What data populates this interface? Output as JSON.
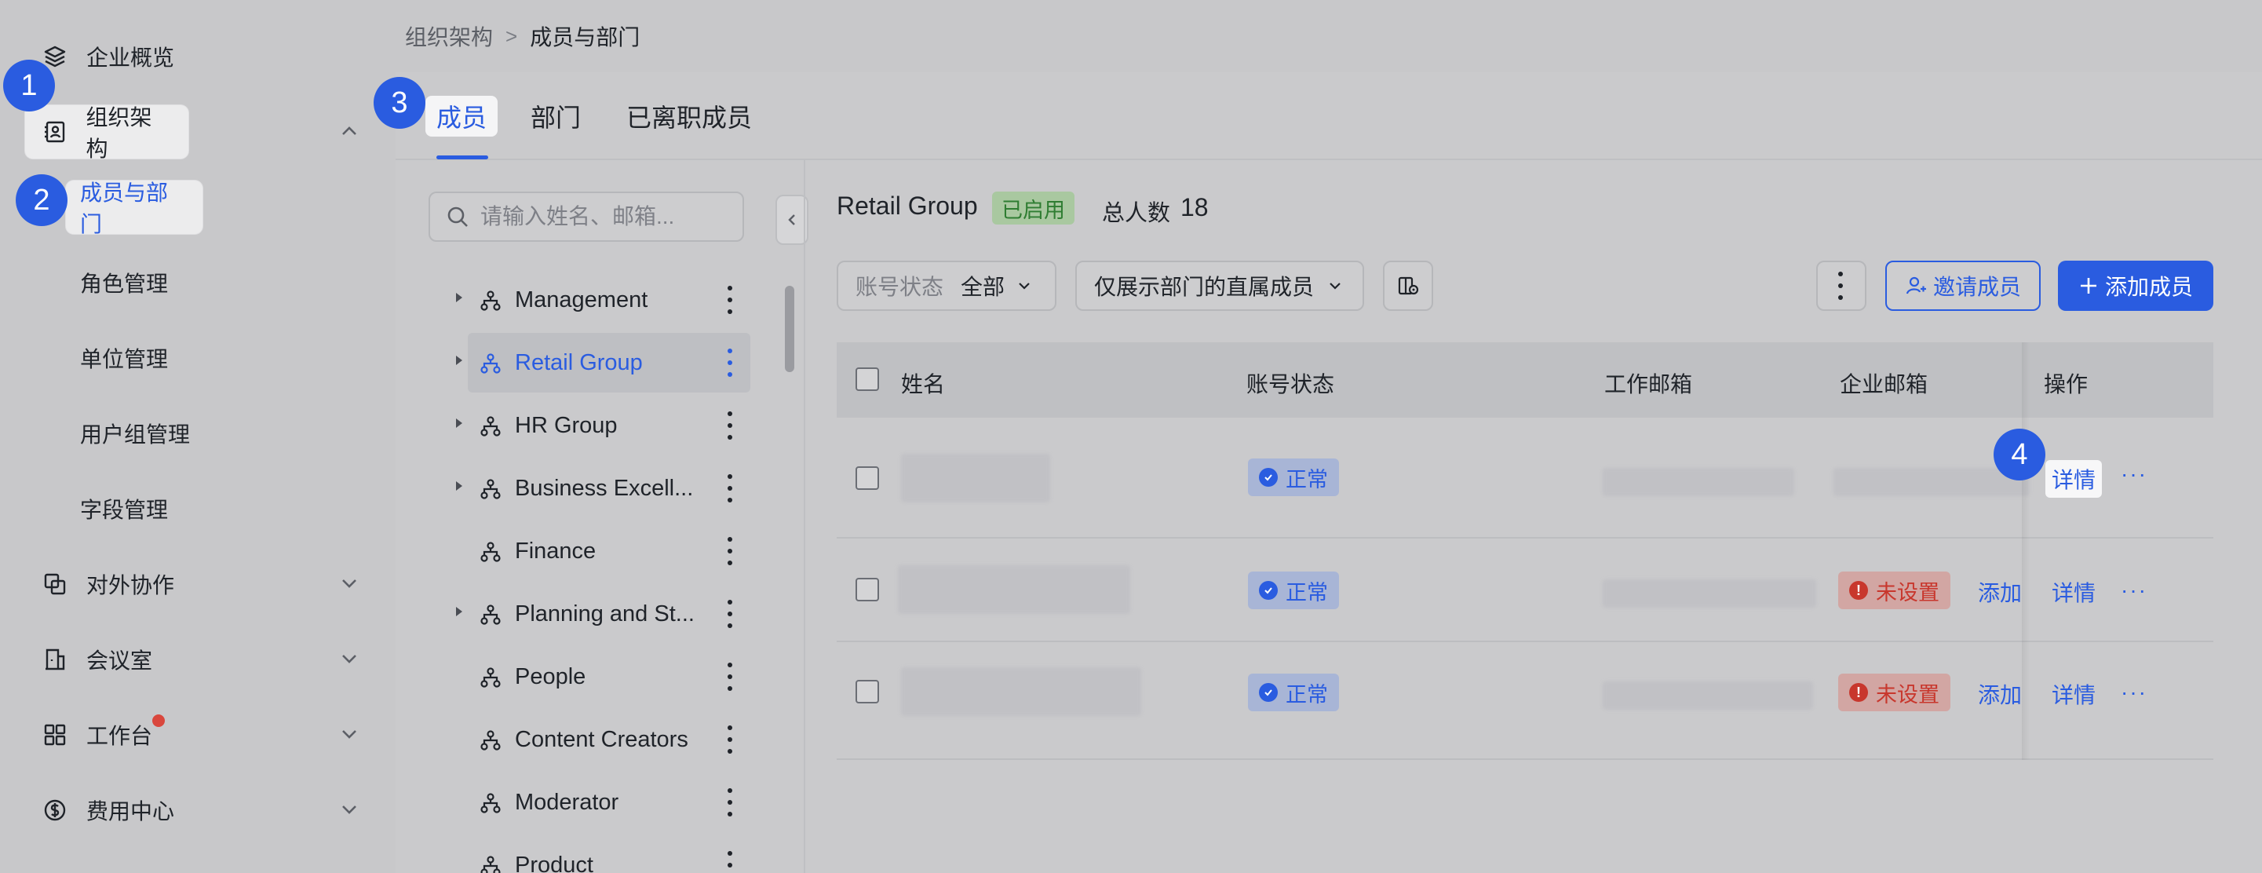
{
  "sidebar": {
    "overview": "企业概览",
    "org": "组织架构",
    "members_depts": "成员与部门",
    "roles": "角色管理",
    "units": "单位管理",
    "user_groups": "用户组管理",
    "fields": "字段管理",
    "external": "对外协作",
    "meeting_rooms": "会议室",
    "workbench": "工作台",
    "billing": "费用中心"
  },
  "steps": [
    "1",
    "2",
    "3",
    "4"
  ],
  "breadcrumb": {
    "parent": "组织架构",
    "sep": ">",
    "current": "成员与部门"
  },
  "tabs": {
    "members": "成员",
    "departments": "部门",
    "departed": "已离职成员"
  },
  "tree": {
    "search_placeholder": "请输入姓名、邮箱...",
    "items": [
      {
        "label": "Management",
        "expandable": true
      },
      {
        "label": "Retail Group",
        "expandable": true,
        "selected": true
      },
      {
        "label": "HR Group",
        "expandable": true
      },
      {
        "label": "Business Excell...",
        "expandable": true
      },
      {
        "label": "Finance",
        "expandable": false
      },
      {
        "label": "Planning and St...",
        "expandable": true
      },
      {
        "label": "People",
        "expandable": false
      },
      {
        "label": "Content Creators",
        "expandable": false
      },
      {
        "label": "Moderator",
        "expandable": false
      },
      {
        "label": "Product",
        "expandable": false
      }
    ]
  },
  "panel": {
    "group_name": "Retail Group",
    "enabled_tag": "已启用",
    "total_label": "总人数",
    "total_count": "18",
    "filter_status_label": "账号状态",
    "filter_status_value": "全部",
    "filter_direct": "仅展示部门的直属成员",
    "invite_button": "邀请成员",
    "add_button": "添加成员"
  },
  "table": {
    "headers": {
      "name": "姓名",
      "status": "账号状态",
      "work_email": "工作邮箱",
      "corp_email": "企业邮箱",
      "actions": "操作"
    },
    "rows": [
      {
        "status": "正常",
        "corp_email_status": "",
        "add_link": "",
        "detail": "详情",
        "more": "···"
      },
      {
        "status": "正常",
        "corp_email_status": "未设置",
        "add_link": "添加",
        "detail": "详情",
        "more": "···"
      },
      {
        "status": "正常",
        "corp_email_status": "未设置",
        "add_link": "添加",
        "detail": "详情",
        "more": "···"
      }
    ]
  },
  "colors": {
    "accent": "#2a5ce0",
    "success": "#2f7d32",
    "danger": "#c8372d"
  }
}
